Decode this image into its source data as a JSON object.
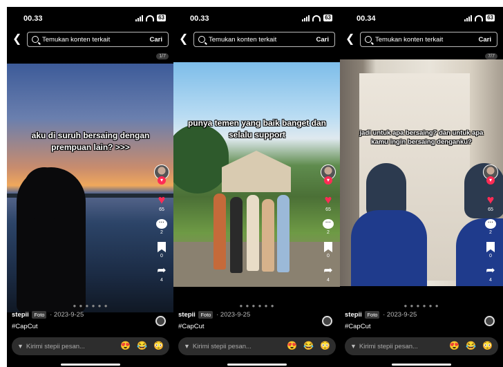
{
  "phones": [
    {
      "status": {
        "time": "00.33",
        "battery": "63"
      },
      "search": {
        "placeholder": "Temukan konten terkait",
        "button": "Cari"
      },
      "page_indicator": "1/7",
      "caption": "aku di suruh bersaing dengan prempuan lain? >>>",
      "counts": {
        "likes": "65",
        "comments": "2",
        "saves": "0",
        "shares": "4"
      },
      "carousel_dots": "● ● ● ● ● ●",
      "author": "stepii",
      "badge": "Foto",
      "date": "· 2023-9-25",
      "hashtag": "#CapCut",
      "message_placeholder": "Kirimi stepii pesan...",
      "emojis": [
        "😍",
        "😂",
        "😳"
      ]
    },
    {
      "status": {
        "time": "00.33",
        "battery": "63"
      },
      "search": {
        "placeholder": "Temukan konten terkait",
        "button": "Cari"
      },
      "page_indicator": "",
      "caption": "punya temen yang baik banget dan selalu support",
      "counts": {
        "likes": "65",
        "comments": "2",
        "saves": "0",
        "shares": "4"
      },
      "carousel_dots": "● ● ● ● ● ●",
      "author": "stepii",
      "badge": "Foto",
      "date": "· 2023-9-25",
      "hashtag": "#CapCut",
      "message_placeholder": "Kirimi stepii pesan...",
      "emojis": [
        "😍",
        "😂",
        "😳"
      ]
    },
    {
      "status": {
        "time": "00.34",
        "battery": "63"
      },
      "search": {
        "placeholder": "Temukan konten terkait",
        "button": "Cari"
      },
      "page_indicator": "7/7",
      "caption": "jadi untuk apa bersaing? dan untuk apa kamu ingin bersaing denganku?",
      "counts": {
        "likes": "65",
        "comments": "2",
        "saves": "0",
        "shares": "4"
      },
      "carousel_dots": "● ● ● ● ● ●",
      "author": "stepii",
      "badge": "Foto",
      "date": "· 2023-9-25",
      "hashtag": "#CapCut",
      "message_placeholder": "Kirimi stepii pesan...",
      "emojis": [
        "😍",
        "😂",
        "😳"
      ]
    }
  ],
  "colors": {
    "like_red": "#fe2c55",
    "background": "#000000"
  },
  "icons": [
    "back-icon",
    "search-icon",
    "follow-plus-icon",
    "heart-icon",
    "comment-icon",
    "bookmark-icon",
    "share-icon",
    "send-icon",
    "music-disc-icon"
  ]
}
